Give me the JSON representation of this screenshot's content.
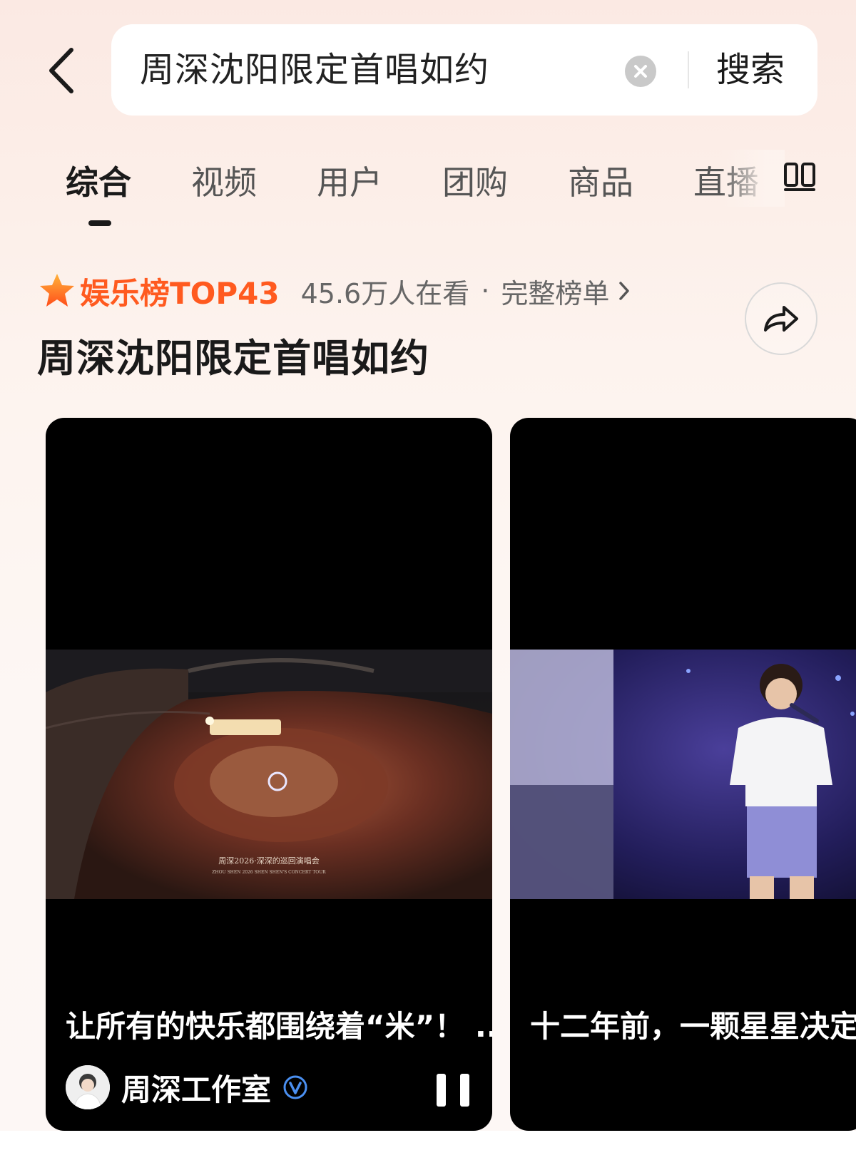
{
  "search": {
    "query": "周深沈阳限定首唱如约",
    "submit_label": "搜索"
  },
  "tabs": [
    {
      "label": "综合",
      "active": true
    },
    {
      "label": "视频",
      "active": false
    },
    {
      "label": "用户",
      "active": false
    },
    {
      "label": "团购",
      "active": false
    },
    {
      "label": "商品",
      "active": false
    },
    {
      "label": "直播",
      "active": false
    }
  ],
  "ranking": {
    "label": "娱乐榜TOP43",
    "viewers": "45.6万人在看",
    "separator": "·",
    "full_list_link": "完整榜单"
  },
  "topic": {
    "title": "周深沈阳限定首唱如约"
  },
  "videos": [
    {
      "caption": "让所有的快乐都围绕着“米”！ ...",
      "author": "周深工作室",
      "verified": true,
      "state": "playing",
      "frame_overlay_line1": "周深2026·深深的巡回演唱会",
      "frame_overlay_line2": "ZHOU SHEN 2026 SHEN SHEN'S CONCERT TOUR"
    },
    {
      "caption": "十二年前，一颗星星决定",
      "author": "",
      "verified": false,
      "state": "paused"
    }
  ],
  "colors": {
    "accent": "#ff5a1f",
    "background_top": "#fbe9e3",
    "card_bg": "#000000"
  },
  "icons": {
    "back": "chevron-left-icon",
    "clear": "clear-circle-icon",
    "more_tabs": "grid-icon",
    "rank_badge": "star-icon",
    "share": "share-arrow-icon",
    "verified": "verified-badge-icon",
    "pause": "pause-icon"
  }
}
